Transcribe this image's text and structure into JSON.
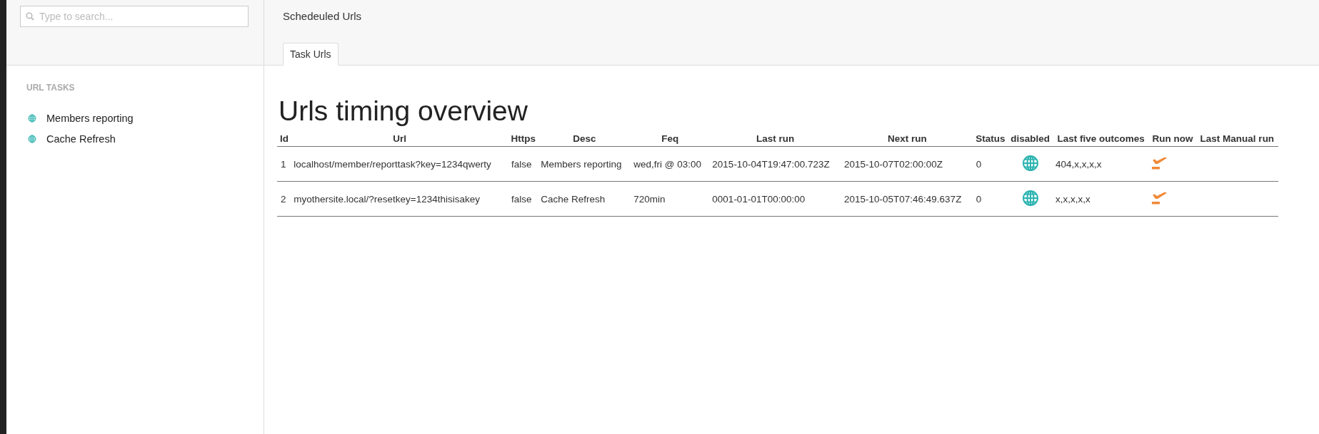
{
  "sidebar": {
    "search": {
      "placeholder": "Type to search..."
    },
    "section_title": "URL TASKS",
    "items": [
      {
        "label": "Members reporting"
      },
      {
        "label": "Cache Refresh"
      }
    ]
  },
  "header": {
    "title": "Schedeuled Urls",
    "tabs": [
      {
        "label": "Task Urls",
        "selected": true
      }
    ]
  },
  "content": {
    "heading": "Urls timing overview",
    "table": {
      "columns": [
        "Id",
        "Url",
        "Https",
        "Desc",
        "Feq",
        "Last run",
        "Next run",
        "Status",
        "disabled",
        "Last five outcomes",
        "Run now",
        "Last Manual run"
      ],
      "rows": [
        {
          "id": "1",
          "url": "localhost/member/reporttask?key=1234qwerty",
          "https": "false",
          "desc": "Members reporting",
          "feq": "wed,fri @ 03:00",
          "last_run": "2015-10-04T19:47:00.723Z",
          "next_run": "2015-10-07T02:00:00Z",
          "status": "0",
          "last_five_outcomes": "404,x,x,x,x"
        },
        {
          "id": "2",
          "url": "myothersite.local/?resetkey=1234thisisakey",
          "https": "false",
          "desc": "Cache Refresh",
          "feq": "720min",
          "last_run": "0001-01-01T00:00:00",
          "next_run": "2015-10-05T07:46:49.637Z",
          "status": "0",
          "last_five_outcomes": "x,x,x,x,x"
        }
      ]
    }
  }
}
